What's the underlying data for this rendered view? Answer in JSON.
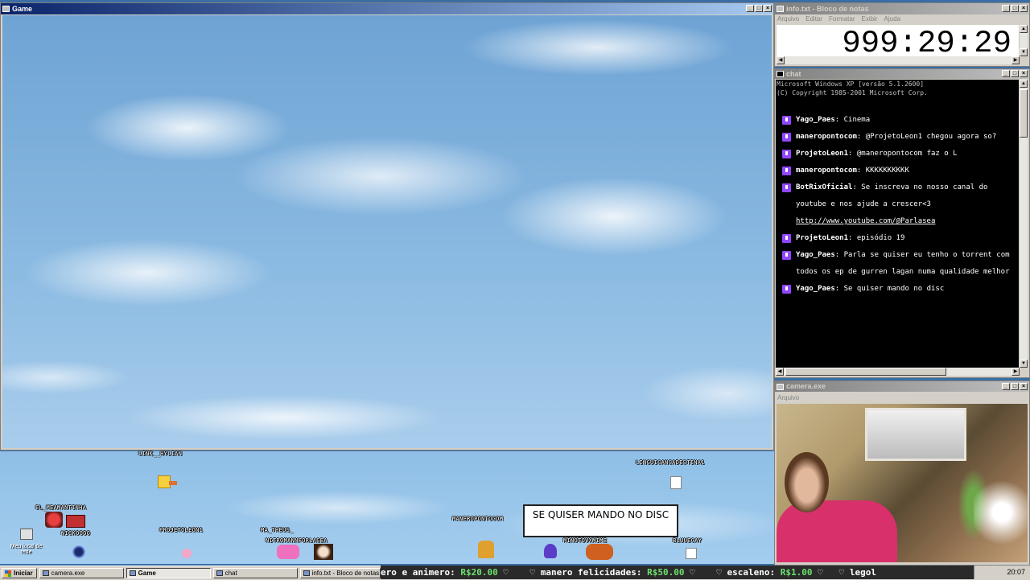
{
  "game_window": {
    "title": "Game"
  },
  "overlay": {
    "players": [
      {
        "name": "LINK__HYLIAN"
      },
      {
        "name": "EL_MEAMANTINHA"
      },
      {
        "name": "NICKOOOO"
      },
      {
        "name": "PROJETOLEON1"
      },
      {
        "name": "MA_THEUS_"
      },
      {
        "name": "NITROMANNFORLASEA"
      },
      {
        "name": "MANEROPONTOCOM"
      },
      {
        "name": "MINOTOVXMIME"
      },
      {
        "name": "BLUUECAY"
      },
      {
        "name": "LINGUICANCADESTINA1"
      }
    ],
    "speech_bubble": "SE QUISER MANDO NO DISC",
    "desktop_icon_label": "Meu local de rede"
  },
  "notepad": {
    "title": "info.txt - Bloco de notas",
    "menu": [
      "Arquivo",
      "Editar",
      "Formatar",
      "Exibir",
      "Ajuda"
    ],
    "content": "999:29:29"
  },
  "chat": {
    "title": "chat",
    "header_lines": [
      "Microsoft Windows XP [versão 5.1.2600]",
      "(C) Copyright 1985-2001 Microsoft Corp."
    ],
    "messages": [
      {
        "user": "Yago_Paes",
        "text": "Cinema"
      },
      {
        "user": "maneropontocom",
        "text": "@ProjetoLeon1 chegou agora so?"
      },
      {
        "user": "ProjetoLeon1",
        "text": "@maneropontocom faz o L"
      },
      {
        "user": "maneropontocom",
        "text": "KKKKKKKKKK"
      },
      {
        "user": "BotRixOficial",
        "text": "Se inscreva no nosso canal do youtube e nos ajude a crescer<3",
        "link": "http://www.youtube.com/@Parlasea"
      },
      {
        "user": "ProjetoLeon1",
        "text": "episódio 19"
      },
      {
        "user": "Yago_Paes",
        "text": "Parla se quiser eu tenho o torrent com todos os ep de gurren lagan numa qualidade melhor"
      },
      {
        "user": "Yago_Paes",
        "text": "Se quiser mando no disc"
      }
    ],
    "badge_color": "#9146ff"
  },
  "camera": {
    "title": "camera.exe",
    "menu": [
      "Arquivo"
    ]
  },
  "taskbar": {
    "start_label": "Iniciar",
    "tasks": [
      {
        "label": "camera.exe"
      },
      {
        "label": "Game"
      },
      {
        "label": "chat"
      },
      {
        "label": "info.txt - Bloco de notas"
      }
    ],
    "ticker": [
      {
        "text": "ero e animero: ",
        "amount": "R$20.00"
      },
      {
        "text": "manero felicidades: ",
        "amount": "R$50.00"
      },
      {
        "text": "escaleno: ",
        "amount": "R$1.00"
      },
      {
        "text": "legol",
        "amount": ""
      }
    ],
    "clock": "20:07"
  }
}
